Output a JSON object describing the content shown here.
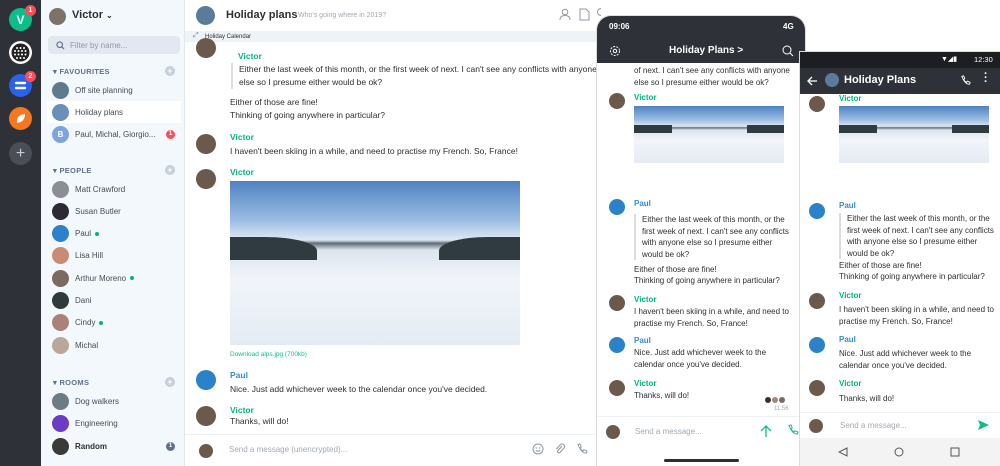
{
  "rail": {
    "workspace_letter": "V",
    "badge1": "1",
    "badge2": "2"
  },
  "user": {
    "name": "Victor"
  },
  "filter": {
    "placeholder": "Filter by name..."
  },
  "sections": {
    "favourites": "FAVOURITES",
    "people": "PEOPLE",
    "rooms": "ROOMS"
  },
  "favourites": [
    {
      "label": "Off site planning",
      "color": "#5e7a8c"
    },
    {
      "label": "Holiday plans",
      "color": "#6a8fb8",
      "selected": true
    },
    {
      "label": "Paul, Michal, Giorgio...",
      "color": "#7ba4e0",
      "letter": "B",
      "count": "1"
    }
  ],
  "people": [
    {
      "label": "Matt Crawford",
      "color": "#8b8f95"
    },
    {
      "label": "Susan Butler",
      "color": "#2d2a35"
    },
    {
      "label": "Paul",
      "color": "#2c82c9",
      "online": true
    },
    {
      "label": "Lisa Hill",
      "color": "#c98b74"
    },
    {
      "label": "Arthur Moreno",
      "color": "#7d6a5e",
      "online": true
    },
    {
      "label": "Dani",
      "color": "#2f3a3a"
    },
    {
      "label": "Cindy",
      "color": "#a98476",
      "online": true
    },
    {
      "label": "Michal",
      "color": "#b9a89a"
    }
  ],
  "rooms": [
    {
      "label": "Dog walkers",
      "color": "#6d7b85"
    },
    {
      "label": "Engineering",
      "color": "#6b3cc4"
    },
    {
      "label": "Random",
      "color": "#3a3a3a",
      "bold": true,
      "count": "1"
    }
  ],
  "room": {
    "title": "Holiday plans",
    "topic": "Who's going where in 2019?",
    "tag": "Holiday Calendar"
  },
  "timeline": {
    "victor": "Victor",
    "paul": "Paul",
    "quote": "Either the last week of this month, or the first week of next. I can't see any conflicts with anyone else so I presume either would be ok?",
    "reply1": "Either of those are fine!",
    "reply2": "Thinking of going anywhere in particular?",
    "skiing": "I haven't been skiing in a while, and need to practise my French. So, France!",
    "download": "Download alps.jpg (700kb)",
    "nice": "Nice. Just add whichever week to the calendar once you've decided.",
    "thanks": "Thanks, will do!"
  },
  "composer": {
    "placeholder": "Send a message (unencrypted)..."
  },
  "ios": {
    "time": "09:06",
    "signal": "4G",
    "title": "Holiday Plans >",
    "top_text": "of next. I can't see any conflicts with anyone else so I presume either would be ok?",
    "placeholder": "Send a message...",
    "timestamp": "11:56"
  },
  "android": {
    "time": "12:30",
    "title": "Holiday Plans",
    "placeholder": "Send a message..."
  }
}
